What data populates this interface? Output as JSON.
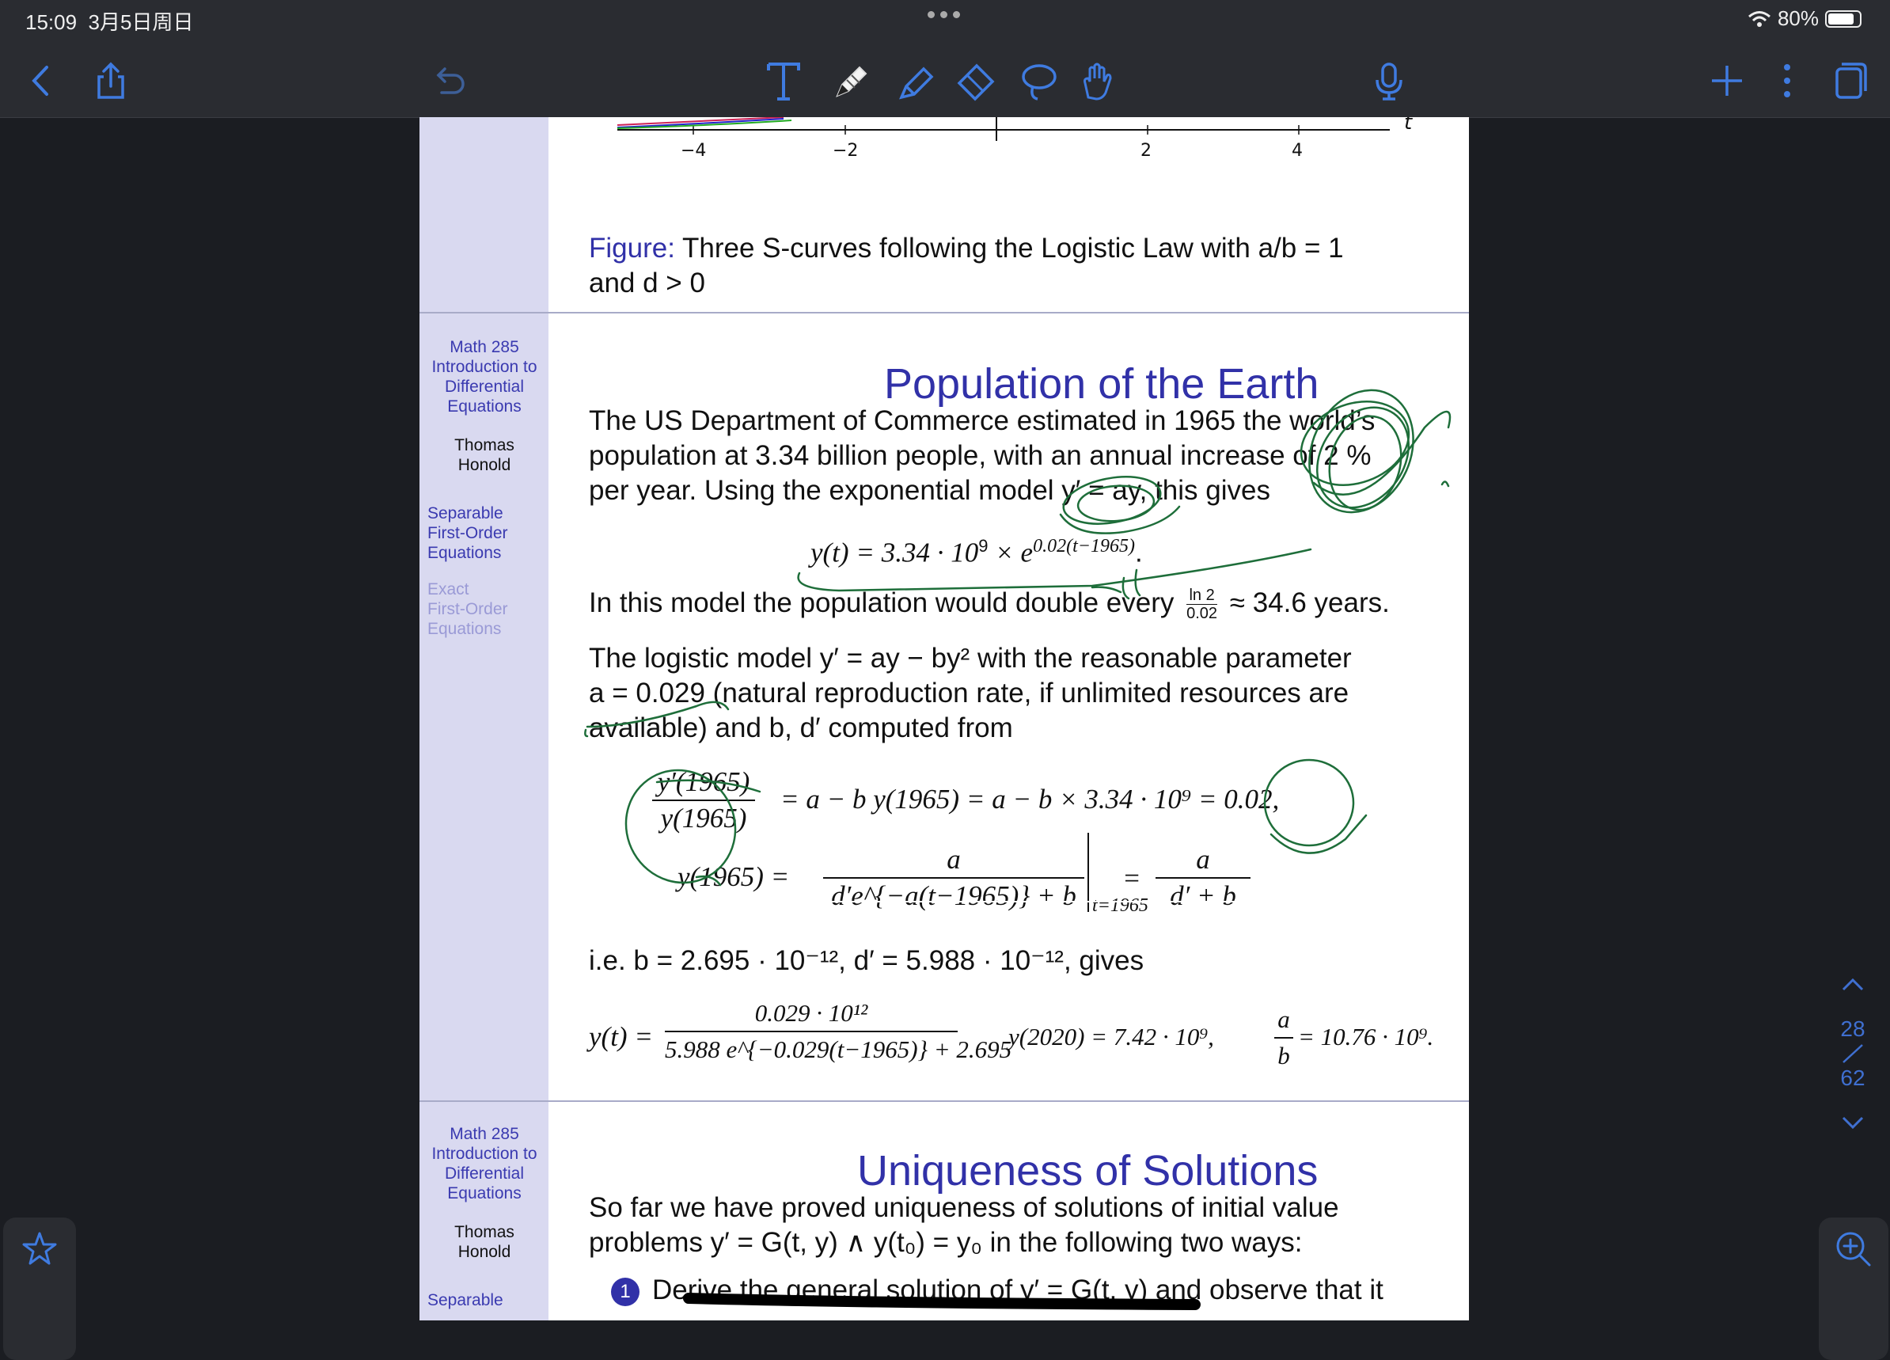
{
  "status": {
    "time": "15:09",
    "date": "3月5日周日",
    "battery": "80%",
    "battery_level": 0.8
  },
  "toolbar": {
    "left_icons": [
      "back-icon",
      "share-icon",
      "undo-icon"
    ],
    "tools": [
      "text-tool-icon",
      "pen-tool-icon",
      "highlighter-tool-icon",
      "eraser-tool-icon",
      "lasso-tool-icon",
      "hand-tool-icon"
    ],
    "right_icons": [
      "microphone-icon",
      "add-icon",
      "more-icon",
      "pages-icon"
    ]
  },
  "slide1": {
    "axis_ticks": [
      "−4",
      "−2",
      "2",
      "4"
    ],
    "axis_var": "t",
    "figure_label": "Figure:",
    "caption_line1": "Three S-curves following the Logistic Law with a/b = 1",
    "caption_line2": "and d > 0"
  },
  "sidebar": {
    "course": [
      "Math 285",
      "Introduction to",
      "Differential",
      "Equations"
    ],
    "author": [
      "Thomas",
      "Honold"
    ],
    "section1": [
      "Separable",
      "First-Order",
      "Equations"
    ],
    "section2": [
      "Exact",
      "First-Order",
      "Equations"
    ]
  },
  "slide2": {
    "title": "Population of the Earth",
    "p1": [
      "The US Department of Commerce estimated in 1965 the world’s",
      "population at 3.34 billion people, with an annual increase of 2 %",
      "per year. Using the exponential model y′ = ay, this gives"
    ],
    "eq1": "y(t) = 3.34 · 10⁹ × e^{0.02(t−1965)}.",
    "eq1_main": "y(t) = 3.34 · 10",
    "eq1_sup9": "9",
    "eq1_tail": " × e",
    "eq1_exp": "0.02(t−1965)",
    "eq1_end": ".",
    "p2_a": "In this model the population would double every",
    "p2_frac_num": "ln 2",
    "p2_frac_den": "0.02",
    "p2_b": "≈ 34.6 years.",
    "p3": [
      "The logistic model y′ = ay − by² with the reasonable parameter",
      "a = 0.029 (natural reproduction rate, if unlimited resources are",
      "available) and b, d′ computed from"
    ],
    "eq2_num": "y′(1965)",
    "eq2_den": "y(1965)",
    "eq2_rhs": "= a − b y(1965) = a − b × 3.34 · 10⁹ = 0.02,",
    "eq3_lhs": "y(1965) =",
    "eq3_frac1_num": "a",
    "eq3_frac1_den": "d′e^{−a(t−1965)} + b",
    "eq3_eval": "t=1965",
    "eq3_eq": "=",
    "eq3_frac2_num": "a",
    "eq3_frac2_den": "d′ + b",
    "p4": "i.e. b = 2.695 · 10⁻¹², d′ = 5.988 · 10⁻¹², gives",
    "eq4_lhs": "y(t) =",
    "eq4_num": "0.029 · 10¹²",
    "eq4_den": "5.988 e^{−0.029(t−1965)} + 2.695",
    "eq4_mid": "y(2020) = 7.42 · 10⁹,",
    "eq4_frac_num": "a",
    "eq4_frac_den": "b",
    "eq4_end": "= 10.76 · 10⁹."
  },
  "slide3": {
    "title": "Uniqueness of Solutions",
    "p1": [
      "So far we have proved uniqueness of solutions of initial value",
      "problems y′ = G(t, y) ∧ y(t₀) = y₀ in the following two ways:"
    ],
    "enum_num": "1",
    "enum_text": "Derive the general solution of y′ = G(t, y) and observe that it",
    "sidebar_section": "Separable"
  },
  "nav": {
    "page_current": "28",
    "page_total": "62"
  }
}
